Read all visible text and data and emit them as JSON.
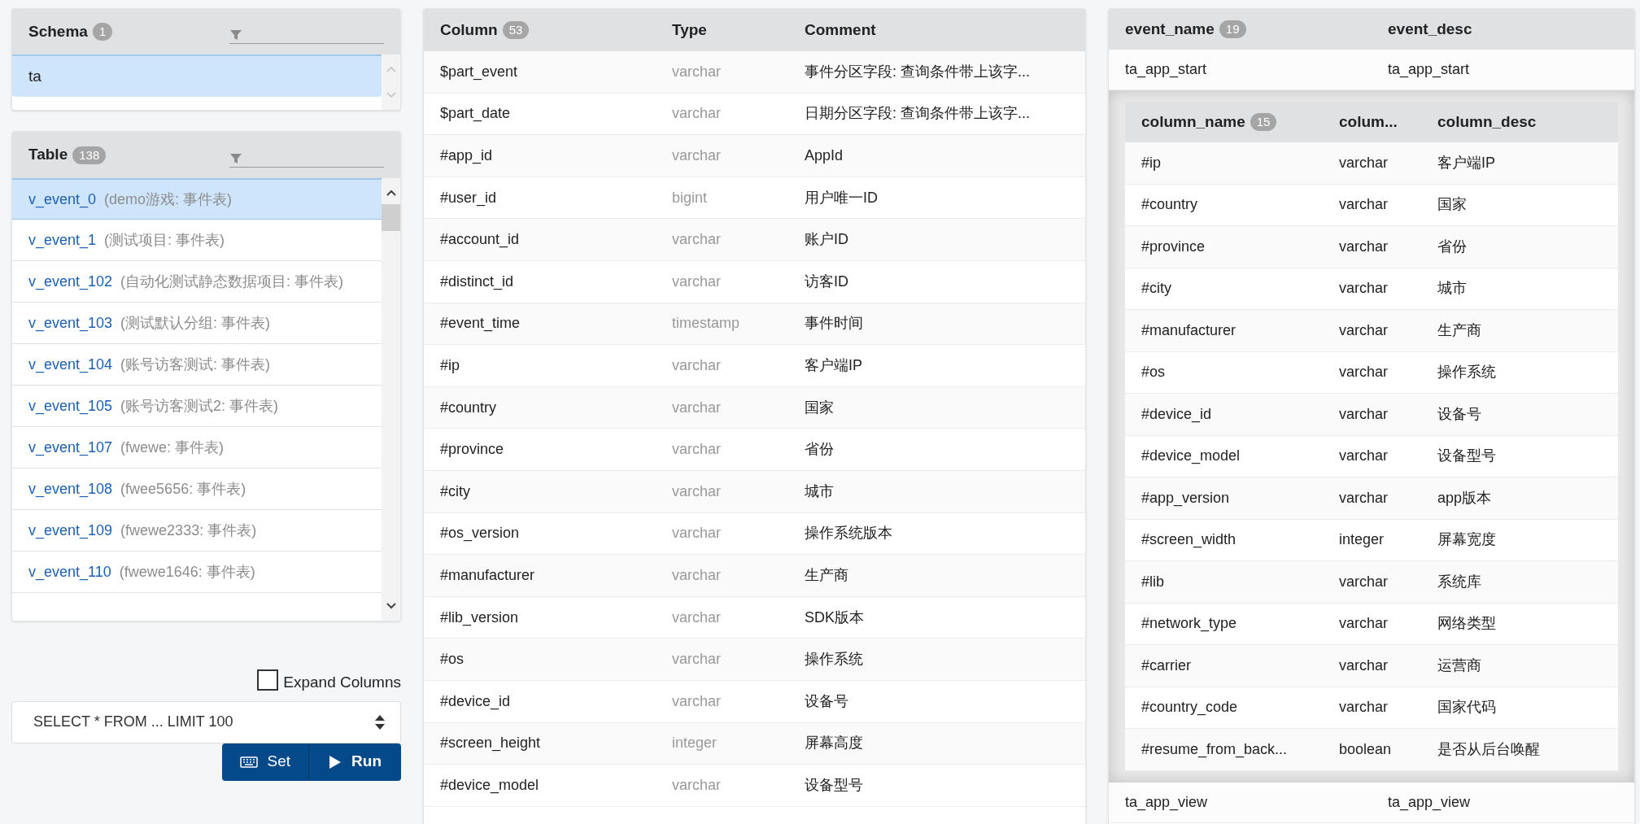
{
  "schema_panel": {
    "title": "Schema",
    "count": "1",
    "items": [
      {
        "name": "ta",
        "selected": true
      }
    ]
  },
  "table_panel": {
    "title": "Table",
    "count": "138",
    "items": [
      {
        "name": "v_event_0",
        "desc": "(demo游戏: 事件表)",
        "selected": true
      },
      {
        "name": "v_event_1",
        "desc": "(测试项目: 事件表)",
        "selected": false
      },
      {
        "name": "v_event_102",
        "desc": "(自动化测试静态数据项目: 事件表)",
        "selected": false
      },
      {
        "name": "v_event_103",
        "desc": "(测试默认分组: 事件表)",
        "selected": false
      },
      {
        "name": "v_event_104",
        "desc": "(账号访客测试: 事件表)",
        "selected": false
      },
      {
        "name": "v_event_105",
        "desc": "(账号访客测试2: 事件表)",
        "selected": false
      },
      {
        "name": "v_event_107",
        "desc": "(fwewe: 事件表)",
        "selected": false
      },
      {
        "name": "v_event_108",
        "desc": "(fwee5656: 事件表)",
        "selected": false
      },
      {
        "name": "v_event_109",
        "desc": "(fwewe2333: 事件表)",
        "selected": false
      },
      {
        "name": "v_event_110",
        "desc": "(fwewe1646: 事件表)",
        "selected": false
      }
    ]
  },
  "expand_columns": {
    "label": "Expand Columns",
    "checked": false
  },
  "query_select": {
    "value": "SELECT * FROM ... LIMIT 100"
  },
  "buttons": [
    {
      "label": "Set",
      "kind": "keyboard"
    },
    {
      "label": "Run",
      "kind": "play"
    }
  ],
  "columns_table": {
    "headers": [
      "Column",
      "Type",
      "Comment"
    ],
    "count": "53",
    "rows": [
      [
        "$part_event",
        "varchar",
        "事件分区字段: 查询条件带上该字..."
      ],
      [
        "$part_date",
        "varchar",
        "日期分区字段: 查询条件带上该字..."
      ],
      [
        "#app_id",
        "varchar",
        "AppId"
      ],
      [
        "#user_id",
        "bigint",
        "用户唯一ID"
      ],
      [
        "#account_id",
        "varchar",
        "账户ID"
      ],
      [
        "#distinct_id",
        "varchar",
        "访客ID"
      ],
      [
        "#event_time",
        "timestamp",
        "事件时间"
      ],
      [
        "#ip",
        "varchar",
        "客户端IP"
      ],
      [
        "#country",
        "varchar",
        "国家"
      ],
      [
        "#province",
        "varchar",
        "省份"
      ],
      [
        "#city",
        "varchar",
        "城市"
      ],
      [
        "#os_version",
        "varchar",
        "操作系统版本"
      ],
      [
        "#manufacturer",
        "varchar",
        "生产商"
      ],
      [
        "#lib_version",
        "varchar",
        "SDK版本"
      ],
      [
        "#os",
        "varchar",
        "操作系统"
      ],
      [
        "#device_id",
        "varchar",
        "设备号"
      ],
      [
        "#screen_height",
        "integer",
        "屏幕高度"
      ],
      [
        "#device_model",
        "varchar",
        "设备型号"
      ]
    ]
  },
  "events_table": {
    "headers": [
      "event_name",
      "event_desc"
    ],
    "count": "19",
    "rows": [
      {
        "event_name": "ta_app_start",
        "event_desc": "ta_app_start",
        "expanded": true,
        "columns": {
          "headers": [
            "column_name",
            "colum...",
            "column_desc"
          ],
          "count": "15",
          "rows": [
            [
              "#ip",
              "varchar",
              "客户端IP"
            ],
            [
              "#country",
              "varchar",
              "国家"
            ],
            [
              "#province",
              "varchar",
              "省份"
            ],
            [
              "#city",
              "varchar",
              "城市"
            ],
            [
              "#manufacturer",
              "varchar",
              "生产商"
            ],
            [
              "#os",
              "varchar",
              "操作系统"
            ],
            [
              "#device_id",
              "varchar",
              "设备号"
            ],
            [
              "#device_model",
              "varchar",
              "设备型号"
            ],
            [
              "#app_version",
              "varchar",
              "app版本"
            ],
            [
              "#screen_width",
              "integer",
              "屏幕宽度"
            ],
            [
              "#lib",
              "varchar",
              "系统库"
            ],
            [
              "#network_type",
              "varchar",
              "网络类型"
            ],
            [
              "#carrier",
              "varchar",
              "运营商"
            ],
            [
              "#country_code",
              "varchar",
              "国家代码"
            ],
            [
              "#resume_from_back...",
              "boolean",
              "是否从后台唤醒"
            ]
          ]
        }
      },
      {
        "event_name": "ta_app_view",
        "event_desc": "ta_app_view",
        "expanded": false
      }
    ]
  }
}
